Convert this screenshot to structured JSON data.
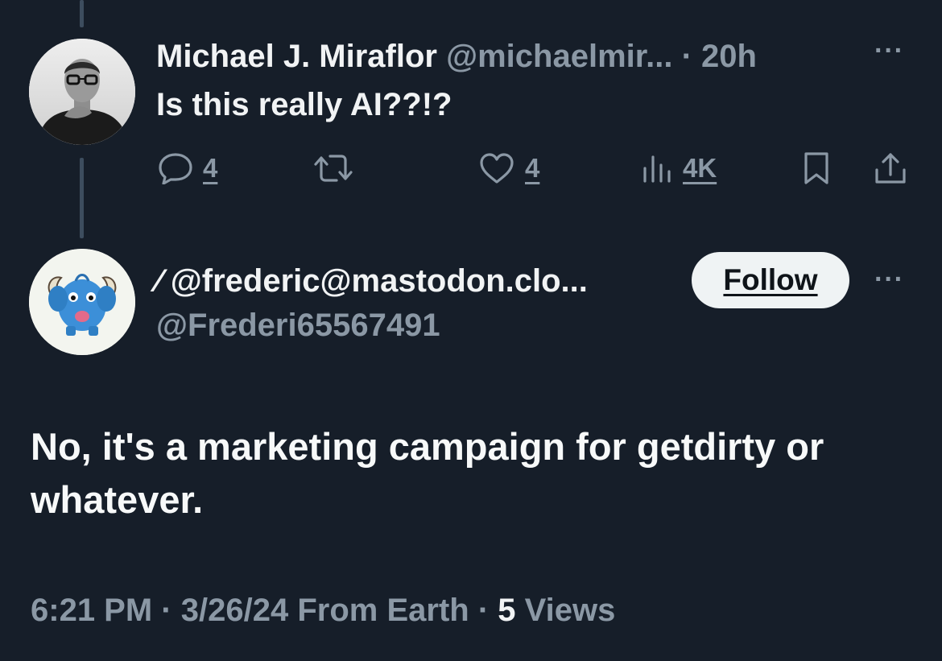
{
  "original_tweet": {
    "display_name": "Michael J. Miraflor",
    "handle": "@michaelmir...",
    "separator": "·",
    "time": "20h",
    "more": "···",
    "text": "Is this really AI??!?",
    "actions": {
      "replies": "4",
      "likes": "4",
      "views": "4K"
    }
  },
  "reply_tweet": {
    "display_name": "⁄ @frederic@mastodon.clo...",
    "handle": "@Frederi65567491",
    "follow_label": "Follow",
    "more": "···",
    "text": "No, it's a marketing campaign for getdirty or whatever.",
    "meta": {
      "time": "6:21 PM",
      "sep1": "·",
      "date": "3/26/24",
      "source": "From Earth",
      "sep2": "·",
      "views_count": "5",
      "views_label": "Views"
    }
  },
  "colors": {
    "background": "#161e29",
    "secondary_text": "#8b98a5",
    "primary_text": "#f1f3f4",
    "follow_button": "#eff3f4"
  },
  "icons": [
    "reply-icon",
    "retweet-icon",
    "like-icon",
    "views-icon",
    "bookmark-icon",
    "share-icon",
    "more-icon"
  ]
}
